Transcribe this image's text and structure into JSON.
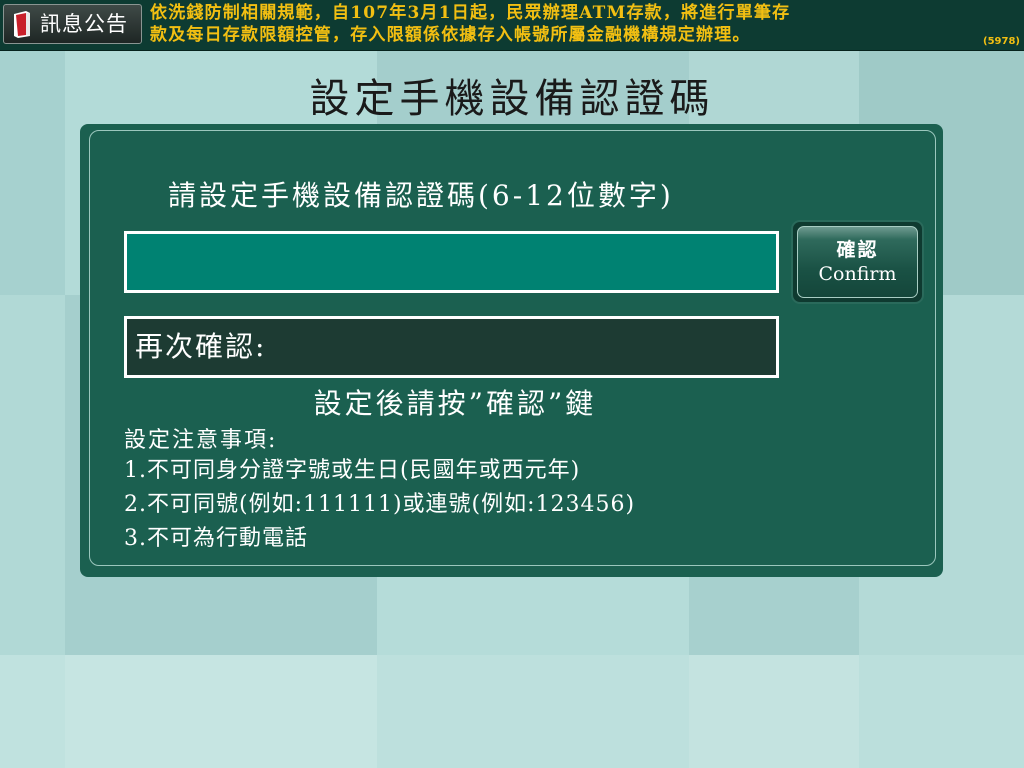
{
  "header": {
    "notice_label": "訊息公告",
    "notice_icon": "document-icon",
    "ticker_line1": "依洗錢防制相關規範，自107年3月1日起，民眾辦理ATM存款，將進行單筆存",
    "ticker_line2": "款及每日存款限額控管，存入限額係依據存入帳號所屬金融機構規定辦理。",
    "screen_code": "(5978)",
    "ticker_color": "#f2bf12"
  },
  "page": {
    "title": "設定手機設備認證碼"
  },
  "form": {
    "prompt": "請設定手機設備認證碼(6-12位數字)",
    "pin_value": "",
    "confirm_label": "再次確認:",
    "confirm_button_zh": "確認",
    "confirm_button_en": "Confirm",
    "hint": "設定後請按”確認”鍵"
  },
  "notes": {
    "title": "設定注意事項:",
    "items": [
      "1.不可同身分證字號或生日(民國年或西元年)",
      "2.不可同號(例如:111111)或連號(例如:123456)",
      "3.不可為行動電話"
    ]
  },
  "colors": {
    "panel": "#1b6050",
    "pin_input": "#008272",
    "confirm_field": "#1d3b33",
    "header": "#0d3b32"
  }
}
